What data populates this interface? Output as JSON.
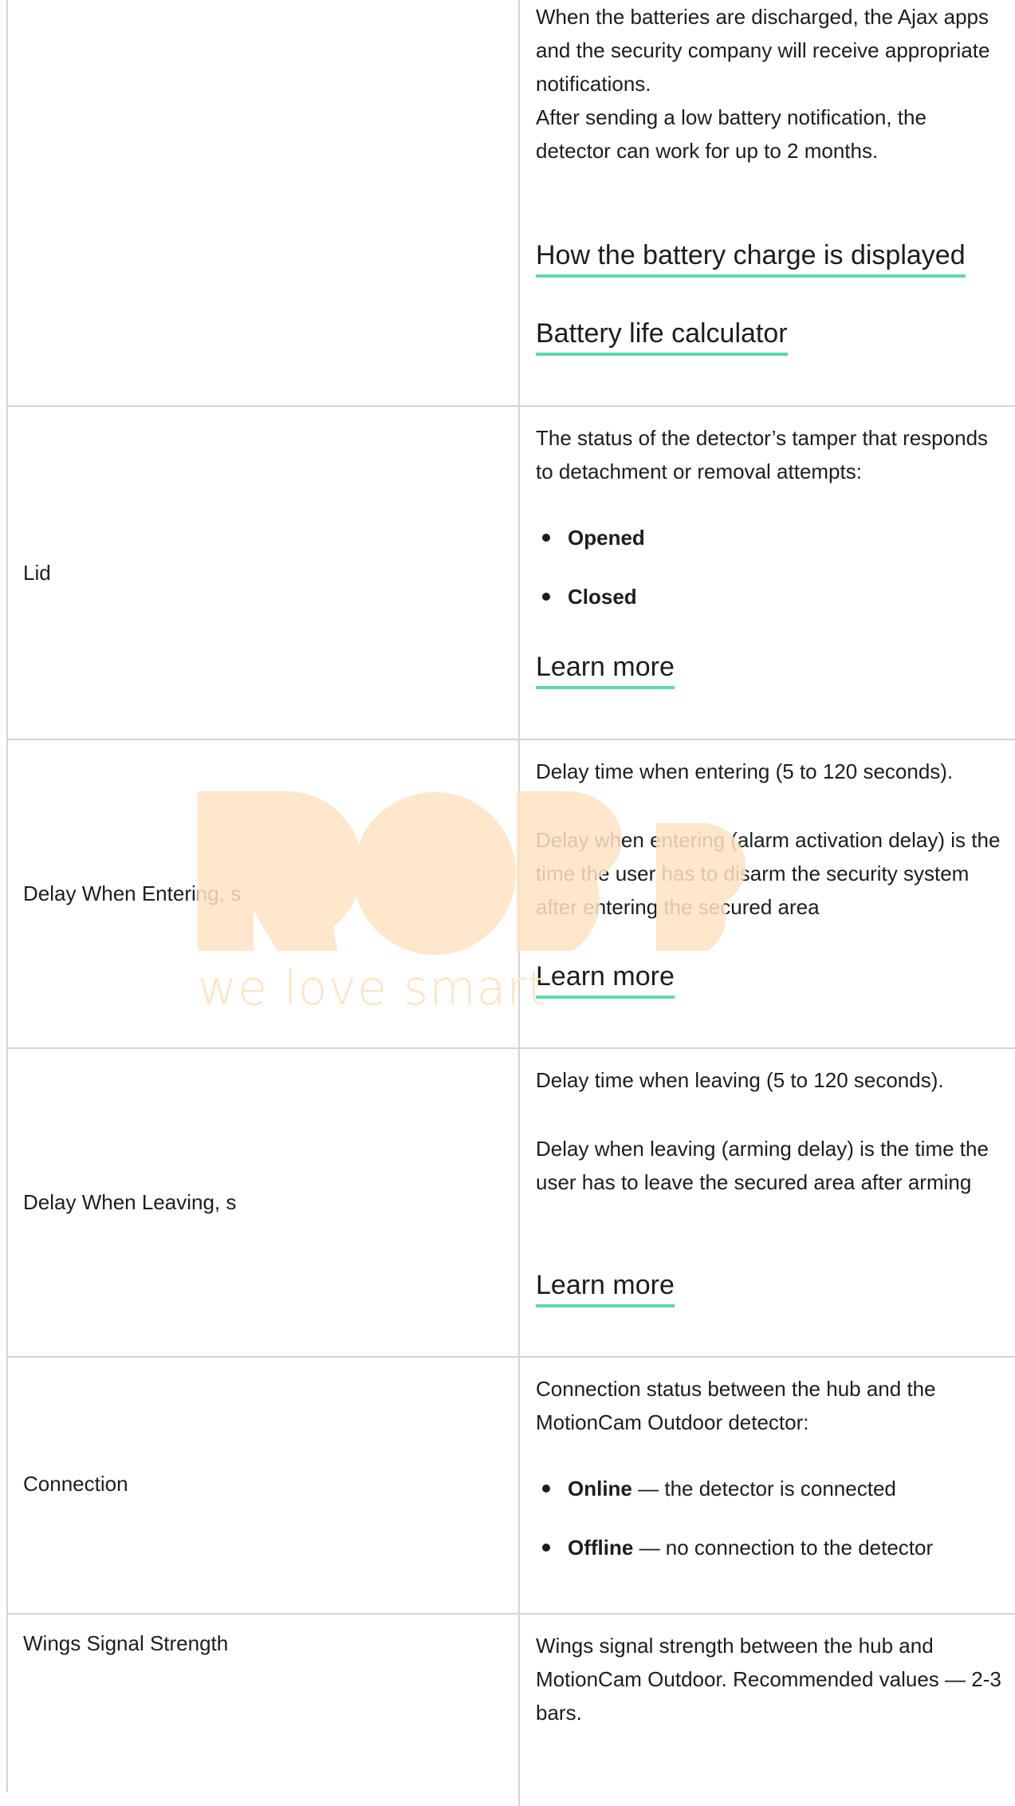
{
  "rows": [
    {
      "paragraphs": [
        "When the batteries are discharged, the Ajax apps and the security company will receive appropriate notifications.",
        "After sending a low battery notification, the detector can work for up to 2 months."
      ],
      "links": [
        "How the battery charge is displayed",
        "Battery life calculator"
      ]
    },
    {
      "label": "Lid",
      "paragraphs": [
        "The status of the detector’s tamper that responds to detachment or removal attempts:"
      ],
      "bullets": [
        {
          "bold": "Opened",
          "rest": ""
        },
        {
          "bold": "Closed",
          "rest": ""
        }
      ],
      "links": [
        "Learn more"
      ]
    },
    {
      "label": "Delay When Entering, s",
      "paragraphs": [
        "Delay time when entering (5 to 120 seconds).",
        "Delay when entering (alarm activation delay) is the time the user has to disarm the security system after entering the secured area"
      ],
      "links": [
        "Learn more"
      ]
    },
    {
      "label": "Delay When Leaving, s",
      "paragraphs": [
        "Delay time when leaving (5 to 120 seconds).",
        "Delay when leaving (arming delay) is the time the user has to leave the secured area after arming"
      ],
      "links": [
        "Learn more"
      ]
    },
    {
      "label": "Connection",
      "paragraphs": [
        "Connection status between the hub and the MotionCam Outdoor detector:"
      ],
      "bullets": [
        {
          "bold": "Online",
          "rest": " — the detector is connected"
        },
        {
          "bold": "Offline",
          "rest": " — no connection to the detector"
        }
      ]
    },
    {
      "label": "Wings Signal Strength",
      "paragraphs": [
        "Wings signal strength between the hub and MotionCam Outdoor. Recommended values — 2-3 bars."
      ]
    }
  ],
  "watermark": {
    "text": "we love smart",
    "logo_color": "#ffe3c4"
  }
}
